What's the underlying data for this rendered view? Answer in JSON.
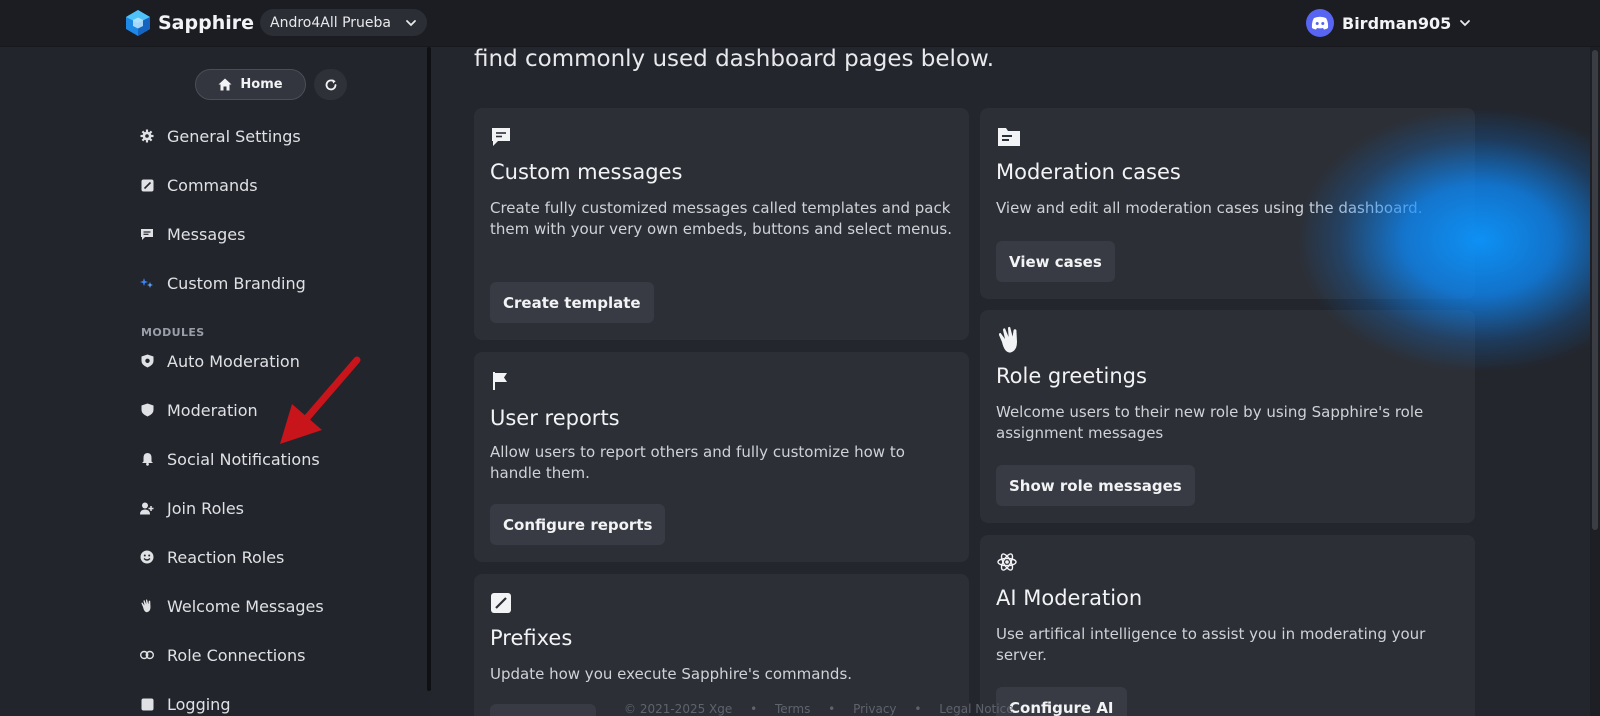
{
  "app": {
    "name": "Sapphire"
  },
  "header": {
    "server": "Andro4All Prueba",
    "username": "Birdman905"
  },
  "sidebar": {
    "home_label": "Home",
    "items": [
      {
        "label": "General Settings",
        "icon": "gear-icon"
      },
      {
        "label": "Commands",
        "icon": "pencil-square-icon"
      },
      {
        "label": "Messages",
        "icon": "message-icon"
      },
      {
        "label": "Custom Branding",
        "icon": "sparkle-icon"
      }
    ],
    "modules_label": "MODULES",
    "modules": [
      {
        "label": "Auto Moderation",
        "icon": "shield-cog-icon"
      },
      {
        "label": "Moderation",
        "icon": "shield-icon"
      },
      {
        "label": "Social Notifications",
        "icon": "bell-icon"
      },
      {
        "label": "Join Roles",
        "icon": "user-plus-icon"
      },
      {
        "label": "Reaction Roles",
        "icon": "smiley-icon"
      },
      {
        "label": "Welcome Messages",
        "icon": "wave-hand-icon"
      },
      {
        "label": "Role Connections",
        "icon": "link-icon"
      },
      {
        "label": "Logging",
        "icon": "log-icon"
      }
    ]
  },
  "main": {
    "intro": "find commonly used dashboard pages below.",
    "cards": [
      {
        "title": "Custom messages",
        "description": "Create fully customized messages called templates and pack them with your very own embeds, buttons and select menus.",
        "button": "Create template",
        "icon": "chat-icon"
      },
      {
        "title": "User reports",
        "description": "Allow users to report others and fully customize how to handle them.",
        "button": "Configure reports",
        "icon": "flag-icon"
      },
      {
        "title": "Prefixes",
        "description": "Update how you execute Sapphire's commands.",
        "button": "",
        "icon": "pencil-square-icon"
      },
      {
        "title": "Moderation cases",
        "description": "View and edit all moderation cases using the dashboard.",
        "button": "View cases",
        "icon": "folder-icon"
      },
      {
        "title": "Role greetings",
        "description": "Welcome users to their new role by using Sapphire's role assignment messages",
        "button": "Show role messages",
        "icon": "wave-hand-icon"
      },
      {
        "title": "AI Moderation",
        "description": "Use artifical intelligence to assist you in moderating your server.",
        "button": "Configure AI",
        "icon": "ai-atom-icon"
      }
    ]
  },
  "footer": {
    "copyright": "© 2021-2025 Xge",
    "links": [
      "Terms",
      "Privacy",
      "Legal Notice"
    ]
  },
  "colors": {
    "accent_glow": "#0c96ff",
    "arrow": "#c8141b",
    "discord": "#5865f2"
  }
}
